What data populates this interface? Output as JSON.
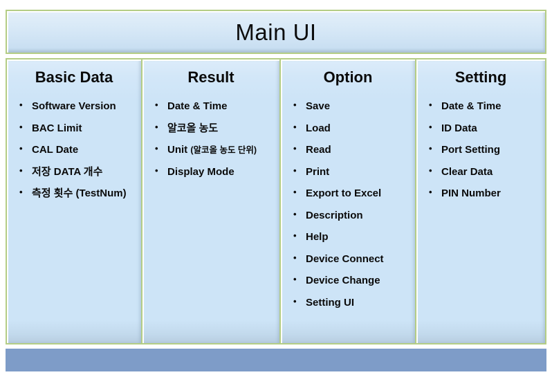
{
  "header": {
    "title": "Main UI"
  },
  "columns": [
    {
      "id": "basic-data",
      "title": "Basic Data",
      "items": [
        {
          "label": "Software Version"
        },
        {
          "label": "BAC Limit"
        },
        {
          "label": "CAL  Date"
        },
        {
          "label": "저장 DATA 개수"
        },
        {
          "label": "측정 횟수 (TestNum)"
        }
      ]
    },
    {
      "id": "result",
      "title": "Result",
      "items": [
        {
          "label": "Date & Time"
        },
        {
          "label": "알코올 농도"
        },
        {
          "label": "Unit ",
          "note": "(알코올 농도 단위)"
        },
        {
          "label": "Display Mode"
        }
      ]
    },
    {
      "id": "option",
      "title": "Option",
      "items": [
        {
          "label": "Save"
        },
        {
          "label": "Load"
        },
        {
          "label": "Read"
        },
        {
          "label": "Print"
        },
        {
          "label": "Export to Excel"
        },
        {
          "label": "Description"
        },
        {
          "label": "Help"
        },
        {
          "label": "Device Connect"
        },
        {
          "label": "Device Change"
        },
        {
          "label": "Setting UI"
        }
      ]
    },
    {
      "id": "setting",
      "title": "Setting",
      "items": [
        {
          "label": "Date & Time"
        },
        {
          "label": "ID Data"
        },
        {
          "label": "Port Setting"
        },
        {
          "label": "Clear Data"
        },
        {
          "label": "PIN Number"
        }
      ]
    }
  ],
  "colors": {
    "panel_fill": "#cde4f7",
    "panel_border": "#b4cd85",
    "footer_bar": "#7e9cc8",
    "text": "#0a0a0a"
  }
}
